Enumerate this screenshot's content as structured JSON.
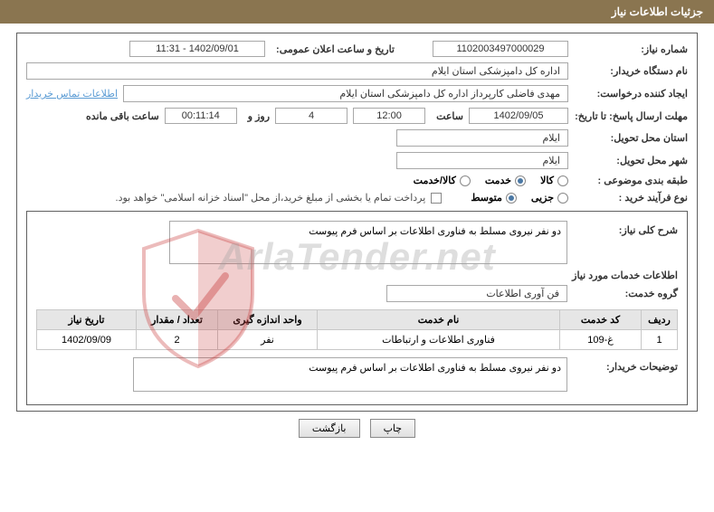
{
  "header": "جزئیات اطلاعات نیاز",
  "needNumber": {
    "label": "شماره نیاز:",
    "value": "1102003497000029"
  },
  "announceDate": {
    "label": "تاریخ و ساعت اعلان عمومی:",
    "value": "1402/09/01 - 11:31"
  },
  "buyerOrg": {
    "label": "نام دستگاه خریدار:",
    "value": "اداره کل دامپزشکی استان ایلام"
  },
  "requester": {
    "label": "ایجاد کننده درخواست:",
    "value": "مهدی فاضلی کارپرداز اداره کل دامپزشکی استان ایلام"
  },
  "contactLink": "اطلاعات تماس خریدار",
  "deadline": {
    "label": "مهلت ارسال پاسخ: تا تاریخ:",
    "date": "1402/09/05",
    "timeLabel": "ساعت",
    "time": "12:00",
    "daysRemaining": "4",
    "daysLabel": "روز و",
    "countdown": "00:11:14",
    "remainLabel": "ساعت باقی مانده"
  },
  "deliveryProvince": {
    "label": "استان محل تحویل:",
    "value": "ایلام"
  },
  "deliveryCity": {
    "label": "شهر محل تحویل:",
    "value": "ایلام"
  },
  "subjectClass": {
    "label": "طبقه بندی موضوعی :",
    "options": [
      "کالا",
      "خدمت",
      "کالا/خدمت"
    ],
    "selected": 1
  },
  "purchaseType": {
    "label": "نوع فرآیند خرید :",
    "options": [
      "جزیی",
      "متوسط"
    ],
    "selected": 1,
    "note": "پرداخت تمام یا بخشی از مبلغ خرید،از محل \"اسناد خزانه اسلامی\" خواهد بود."
  },
  "needDesc": {
    "label": "شرح کلی نیاز:",
    "value": "دو نفر نیروی مسلط به فناوری اطلاعات بر اساس فرم پیوست"
  },
  "servicesInfoTitle": "اطلاعات خدمات مورد نیاز",
  "serviceGroup": {
    "label": "گروه خدمت:",
    "value": "فن آوری اطلاعات"
  },
  "table": {
    "headers": [
      "ردیف",
      "کد خدمت",
      "نام خدمت",
      "واحد اندازه گیری",
      "تعداد / مقدار",
      "تاریخ نیاز"
    ],
    "rows": [
      [
        "1",
        "غ-109",
        "فناوری اطلاعات و ارتباطات",
        "نفر",
        "2",
        "1402/09/09"
      ]
    ]
  },
  "buyerNotes": {
    "label": "توضیحات خریدار:",
    "value": "دو نفر نیروی مسلط به فناوری اطلاعات بر اساس فرم پیوست"
  },
  "buttons": {
    "print": "چاپ",
    "back": "بازگشت"
  },
  "watermark": "ArlaTender.net"
}
